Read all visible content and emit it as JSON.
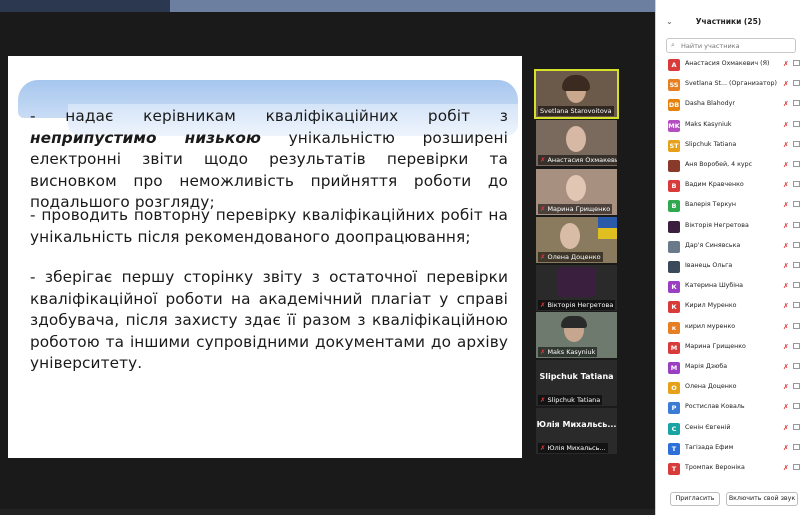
{
  "slide": {
    "p1_a": "- надає керівникам кваліфікаційних робіт з ",
    "p1_b": "неприпустимо низькою",
    "p1_c": " унікальністю розширені електронні звіти щодо результатів перевірки та висновком про  неможливість прийняття роботи до подальшого розгляду;",
    "p2": "- проводить повторну перевірку кваліфікаційних робіт на унікальність після рекомендованого доопрацювання;",
    "p3": "- зберігає першу сторінку звіту з остаточної перевірки кваліфікаційної роботи на академічний плагіат у справі здобувача, після захисту здає її разом з кваліфікаційною роботою та іншими супровідними документами до архіву університету."
  },
  "tiles": [
    {
      "name": "Svetlana Starovoitova",
      "active": true,
      "bg": "#6b5a4a",
      "muted": false
    },
    {
      "name": "Анастасия Охмакевич",
      "bg": "#7a6a5e",
      "muted": true
    },
    {
      "name": "Марина Грищенко",
      "bg": "#a89080",
      "muted": true
    },
    {
      "name": "Олена Доценко",
      "bg": "#8a7a5e",
      "muted": true
    },
    {
      "name": "Вікторія Негретова",
      "bg": "#3a1f3f",
      "muted": true
    },
    {
      "name": "Maks Kasyniuk",
      "bg": "#6e7a6e",
      "muted": true
    },
    {
      "name": "Slipchuk Tatiana",
      "big": "Slipchuk Tatiana",
      "bg": "#2a2a2a",
      "muted": true
    },
    {
      "name": "Юлія Михальсь...",
      "big": "Юлія  Михальсь...",
      "bg": "#2a2a2a",
      "muted": true
    }
  ],
  "panel": {
    "title": "Участники (25)",
    "search_placeholder": "Найти участника",
    "participants": [
      {
        "initials": "А",
        "name": "Анастасия Охмакевич (Я)",
        "color": "#d93b3b"
      },
      {
        "initials": "SS",
        "name": "Svetlana St... (Организатор)",
        "color": "#e67e22",
        "host": true
      },
      {
        "initials": "DB",
        "name": "Dasha Blahodyr",
        "color": "#e6830f"
      },
      {
        "initials": "MK",
        "name": "Maks Kasyniuk",
        "color": "#b44fc2"
      },
      {
        "initials": "ST",
        "name": "Slipchuk Tatiana",
        "color": "#e6a119"
      },
      {
        "initials": "",
        "name": "Аня Воробей, 4 курс",
        "color": "#8a3a2a"
      },
      {
        "initials": "В",
        "name": "Вадим Кравченко",
        "color": "#d93b3b"
      },
      {
        "initials": "В",
        "name": "Валерія Теркун",
        "color": "#2fa84f"
      },
      {
        "initials": "",
        "name": "Вікторія Негретова",
        "color": "#3a1f3f"
      },
      {
        "initials": "",
        "name": "Дар'я Синявська",
        "color": "#6a7a8a"
      },
      {
        "initials": "",
        "name": "Іванець Ольга",
        "color": "#3a4a5a"
      },
      {
        "initials": "К",
        "name": "Катерина Шубіна",
        "color": "#9b3fc2"
      },
      {
        "initials": "К",
        "name": "Кирил Муренко",
        "color": "#d93b3b"
      },
      {
        "initials": "к",
        "name": "кирил муренко",
        "color": "#e67e22"
      },
      {
        "initials": "М",
        "name": "Марина Грищенко",
        "color": "#d93b3b"
      },
      {
        "initials": "М",
        "name": "Марія Дзюба",
        "color": "#9b3fc2"
      },
      {
        "initials": "О",
        "name": "Олена Доценко",
        "color": "#e6a119"
      },
      {
        "initials": "Р",
        "name": "Ростислав Коваль",
        "color": "#3a7bd5"
      },
      {
        "initials": "С",
        "name": "Сенін Євгеній",
        "color": "#1aa3a3"
      },
      {
        "initials": "Т",
        "name": "Тагізада Ефим",
        "color": "#2b6fd9"
      },
      {
        "initials": "Т",
        "name": "Тромпак Вероніка",
        "color": "#d93b3b"
      }
    ],
    "invite_label": "Пригласить",
    "unmute_label": "Включить свой звук"
  }
}
